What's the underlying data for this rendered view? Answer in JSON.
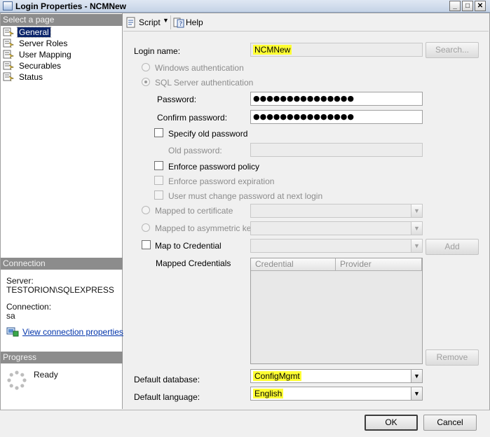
{
  "window": {
    "title": "Login Properties - NCMNew",
    "min_glyph": "_",
    "max_glyph": "□",
    "close_glyph": "✕"
  },
  "left": {
    "select_page_header": "Select a page",
    "pages": [
      {
        "label": "General",
        "selected": true
      },
      {
        "label": "Server Roles"
      },
      {
        "label": "User Mapping"
      },
      {
        "label": "Securables"
      },
      {
        "label": "Status"
      }
    ],
    "connection_header": "Connection",
    "server_label": "Server:",
    "server_value": "TESTORION\\SQLEXPRESS",
    "connection_label": "Connection:",
    "connection_value": "sa",
    "view_connection_link": "View connection properties",
    "progress_header": "Progress",
    "progress_status": "Ready"
  },
  "toolbar": {
    "script_label": "Script",
    "help_label": "Help"
  },
  "form": {
    "login_name_label": "Login name:",
    "login_name_value": "NCMNew",
    "search_button": "Search...",
    "windows_auth_label": "Windows authentication",
    "sql_auth_label": "SQL Server authentication",
    "password_label": "Password:",
    "password_value": "●●●●●●●●●●●●●●●",
    "confirm_password_label": "Confirm password:",
    "confirm_password_value": "●●●●●●●●●●●●●●●",
    "specify_old_password_label": "Specify old password",
    "old_password_label": "Old password:",
    "enforce_policy_label": "Enforce password policy",
    "enforce_expiration_label": "Enforce password expiration",
    "must_change_label": "User must change password at next login",
    "mapped_cert_label": "Mapped to certificate",
    "mapped_asym_key_label": "Mapped to asymmetric key",
    "map_credential_label": "Map to Credential",
    "add_button": "Add",
    "mapped_credentials_label": "Mapped Credentials",
    "grid_columns": [
      "Credential",
      "Provider"
    ],
    "remove_button": "Remove",
    "default_database_label": "Default database:",
    "default_database_value": "ConfigMgmt",
    "default_language_label": "Default language:",
    "default_language_value": "English"
  },
  "footer": {
    "ok_button": "OK",
    "cancel_button": "Cancel"
  },
  "colors": {
    "highlight": "#ffff33",
    "selection": "#0a246a",
    "pane_header": "#8c8c8c"
  }
}
